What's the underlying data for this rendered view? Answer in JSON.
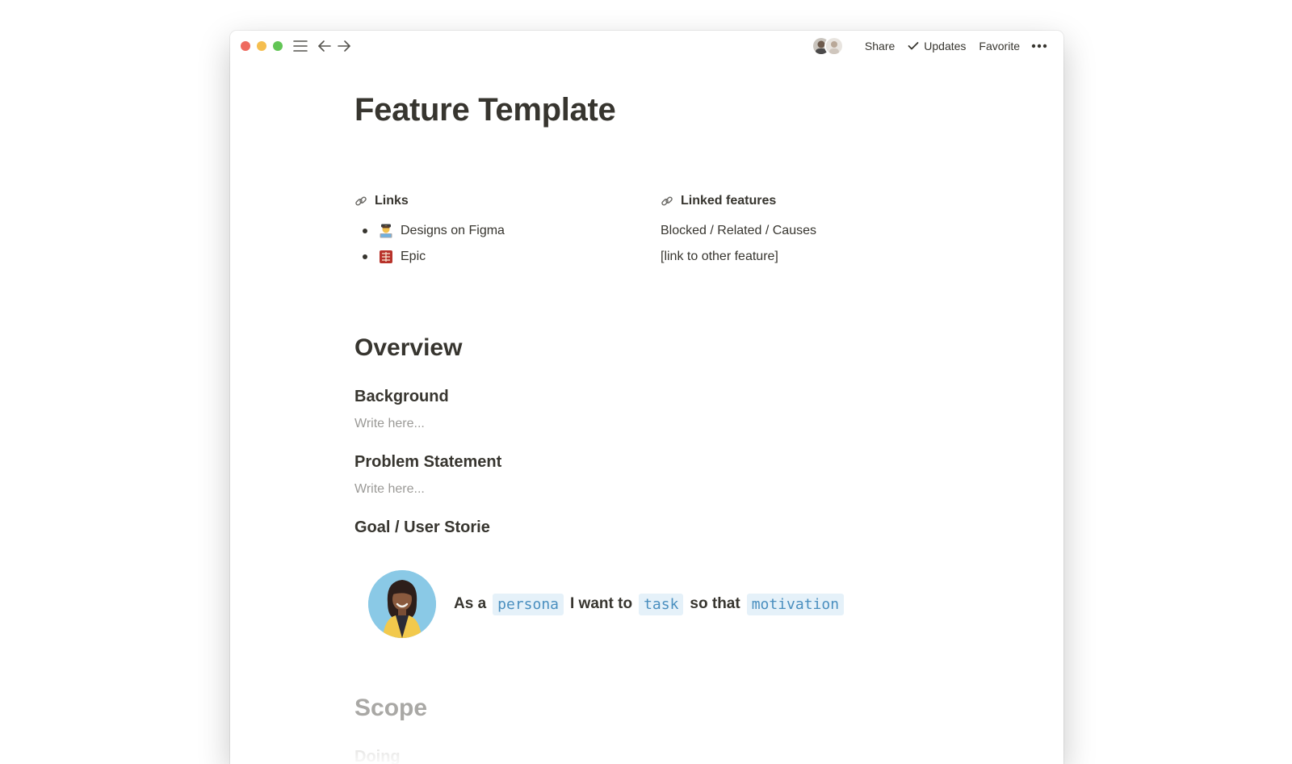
{
  "titlebar": {
    "share_label": "Share",
    "updates_label": "Updates",
    "favorite_label": "Favorite"
  },
  "page": {
    "title": "Feature Template"
  },
  "links": {
    "heading": "Links",
    "items": [
      {
        "emoji": "technologist-emoji",
        "label": "Designs on Figma"
      },
      {
        "emoji": "epic-emoji",
        "label": "Epic"
      }
    ]
  },
  "linked_features": {
    "heading": "Linked features",
    "lines": [
      "Blocked / Related / Causes",
      "[link to other feature]"
    ]
  },
  "overview": {
    "heading": "Overview",
    "background_heading": "Background",
    "background_placeholder": "Write here...",
    "problem_heading": "Problem Statement",
    "problem_placeholder": "Write here...",
    "goal_heading": "Goal / User Storie"
  },
  "story": {
    "as_a": "As a",
    "persona": "persona",
    "i_want_to": "I want to",
    "task": "task",
    "so_that": "so that",
    "motivation": "motivation"
  },
  "scope": {
    "heading": "Scope",
    "doing": "Doing"
  },
  "colors": {
    "text": "#37352f",
    "placeholder": "#9b9a97",
    "chip_text": "#4a8fbf",
    "chip_bg": "#e5f1f9",
    "close": "#ee6a5f",
    "minimize": "#f5be4f",
    "zoom": "#62c555"
  }
}
